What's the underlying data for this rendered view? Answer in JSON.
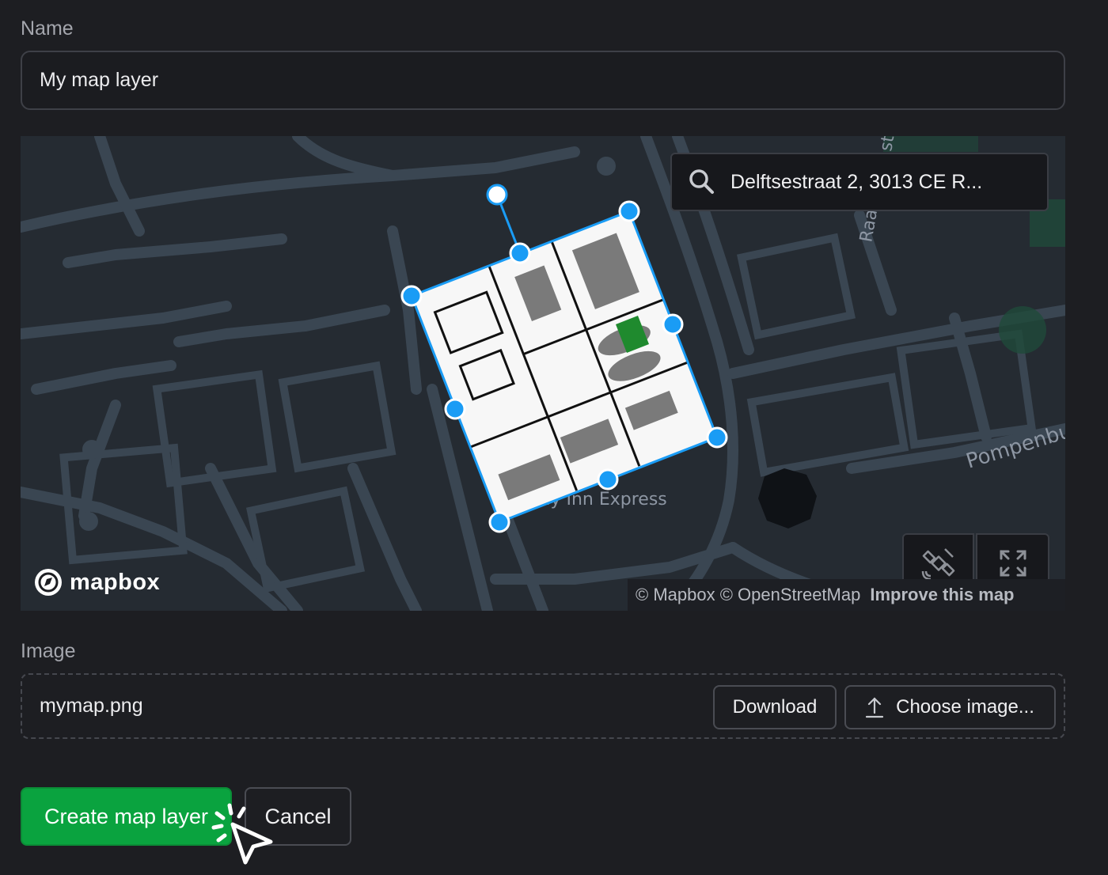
{
  "name_field": {
    "label": "Name",
    "value": "My map layer"
  },
  "map": {
    "search_value": "Delftsestraat 2, 3013 CE R...",
    "logo_text": "mapbox",
    "attribution": "© Mapbox © OpenStreetMap",
    "improve_link": "Improve this map",
    "street_labels": [
      "Pompenbu",
      "Raa",
      "st",
      "ay Inn Express"
    ],
    "controls": [
      "satellite-toggle",
      "fullscreen"
    ]
  },
  "image_field": {
    "label": "Image",
    "file_name": "mymap.png",
    "download_label": "Download",
    "choose_label": "Choose image..."
  },
  "actions": {
    "create_label": "Create map layer",
    "cancel_label": "Cancel"
  },
  "colors": {
    "accent": "#0aa33f",
    "handle": "#1a9cf5",
    "background": "#1d1e22",
    "map_background": "#252b32",
    "road": "#3a4652"
  }
}
